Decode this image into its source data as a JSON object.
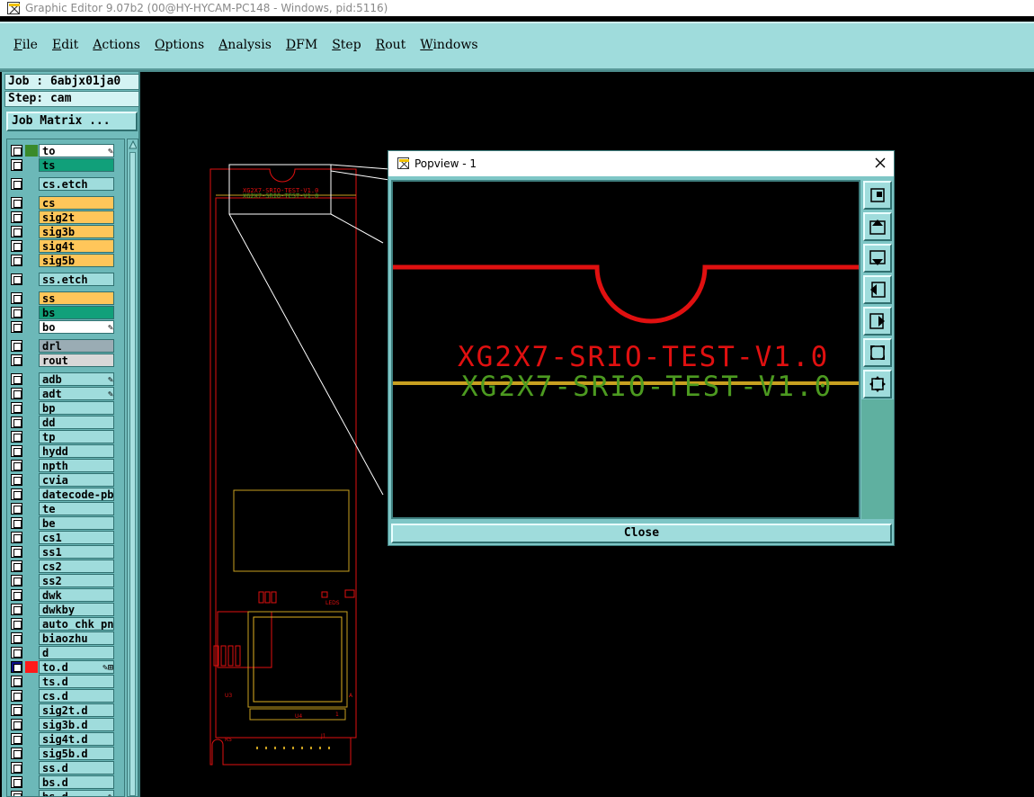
{
  "window": {
    "title": "Graphic Editor 9.07b2 (00@HY-HYCAM-PC148 - Windows, pid:5116)"
  },
  "menu": [
    {
      "label": "File"
    },
    {
      "label": "Edit"
    },
    {
      "label": "Actions"
    },
    {
      "label": "Options"
    },
    {
      "label": "Analysis"
    },
    {
      "label": "DFM"
    },
    {
      "label": "Step"
    },
    {
      "label": "Rout"
    },
    {
      "label": "Windows"
    }
  ],
  "job": {
    "job_text": "Job : 6abjx01ja0",
    "step_text": "Step: cam",
    "matrix_button": "Job Matrix ..."
  },
  "colors": {
    "accent_teal": "#9fdcdc",
    "board_red": "#e01010",
    "silk_yellow": "#c8a020",
    "text_green": "#4c9a20"
  },
  "layers": [
    {
      "name": "to",
      "bg": "#ffffff",
      "swatch": "#3a8a2a",
      "mark": "✎"
    },
    {
      "name": "ts",
      "bg": "#11a07a",
      "swatch": ""
    },
    {
      "name": "cs.etch",
      "bg": "#9fdcdc",
      "swatch": "",
      "gap": true
    },
    {
      "name": "cs",
      "bg": "#ffc65a",
      "swatch": "",
      "gap": true
    },
    {
      "name": "sig2t",
      "bg": "#ffc65a",
      "swatch": ""
    },
    {
      "name": "sig3b",
      "bg": "#ffc65a",
      "swatch": ""
    },
    {
      "name": "sig4t",
      "bg": "#ffc65a",
      "swatch": ""
    },
    {
      "name": "sig5b",
      "bg": "#ffc65a",
      "swatch": ""
    },
    {
      "name": "ss.etch",
      "bg": "#9fdcdc",
      "swatch": "",
      "gap": true
    },
    {
      "name": "ss",
      "bg": "#ffc65a",
      "swatch": "",
      "gap": true
    },
    {
      "name": "bs",
      "bg": "#11a07a",
      "swatch": ""
    },
    {
      "name": "bo",
      "bg": "#ffffff",
      "swatch": "",
      "mark": "✎"
    },
    {
      "name": "drl",
      "bg": "#9aacb4",
      "swatch": "",
      "gap": true
    },
    {
      "name": "rout",
      "bg": "#d8d8d8",
      "swatch": ""
    },
    {
      "name": "adb",
      "bg": "#9fdcdc",
      "swatch": "",
      "mark": "✎",
      "gap": true
    },
    {
      "name": "adt",
      "bg": "#9fdcdc",
      "swatch": "",
      "mark": "✎"
    },
    {
      "name": "bp",
      "bg": "#9fdcdc",
      "swatch": ""
    },
    {
      "name": "dd",
      "bg": "#9fdcdc",
      "swatch": ""
    },
    {
      "name": "tp",
      "bg": "#9fdcdc",
      "swatch": ""
    },
    {
      "name": "hydd",
      "bg": "#9fdcdc",
      "swatch": ""
    },
    {
      "name": "npth",
      "bg": "#9fdcdc",
      "swatch": ""
    },
    {
      "name": "cvia",
      "bg": "#9fdcdc",
      "swatch": ""
    },
    {
      "name": "datecode-pbe",
      "bg": "#9fdcdc",
      "swatch": ""
    },
    {
      "name": "te",
      "bg": "#9fdcdc",
      "swatch": ""
    },
    {
      "name": "be",
      "bg": "#9fdcdc",
      "swatch": ""
    },
    {
      "name": "cs1",
      "bg": "#9fdcdc",
      "swatch": ""
    },
    {
      "name": "ss1",
      "bg": "#9fdcdc",
      "swatch": ""
    },
    {
      "name": "cs2",
      "bg": "#9fdcdc",
      "swatch": ""
    },
    {
      "name": "ss2",
      "bg": "#9fdcdc",
      "swatch": ""
    },
    {
      "name": "dwk",
      "bg": "#9fdcdc",
      "swatch": ""
    },
    {
      "name": "dwkby",
      "bg": "#9fdcdc",
      "swatch": ""
    },
    {
      "name": "auto_chk_pn",
      "bg": "#9fdcdc",
      "swatch": ""
    },
    {
      "name": "biaozhu",
      "bg": "#9fdcdc",
      "swatch": ""
    },
    {
      "name": "d",
      "bg": "#9fdcdc",
      "swatch": ""
    },
    {
      "name": "to.d",
      "bg": "#9fdcdc",
      "swatch": "#ff1a1a",
      "mark": "✎⊞",
      "active": true
    },
    {
      "name": "ts.d",
      "bg": "#9fdcdc",
      "swatch": ""
    },
    {
      "name": "cs.d",
      "bg": "#9fdcdc",
      "swatch": ""
    },
    {
      "name": "sig2t.d",
      "bg": "#9fdcdc",
      "swatch": ""
    },
    {
      "name": "sig3b.d",
      "bg": "#9fdcdc",
      "swatch": ""
    },
    {
      "name": "sig4t.d",
      "bg": "#9fdcdc",
      "swatch": ""
    },
    {
      "name": "sig5b.d",
      "bg": "#9fdcdc",
      "swatch": ""
    },
    {
      "name": "ss.d",
      "bg": "#9fdcdc",
      "swatch": ""
    },
    {
      "name": "bs.d",
      "bg": "#9fdcdc",
      "swatch": ""
    },
    {
      "name": "bs.d",
      "bg": "#9fdcdc",
      "swatch": "",
      "mark": "✎"
    }
  ],
  "board": {
    "small_text_red": "XG2X7-SRIO-TEST-V1.0",
    "small_text_green": "XG2X7-SRIO-TEST-V1.0",
    "refdes": [
      "R16",
      "R18",
      "R20",
      "R19",
      "RATE1",
      "RATE2",
      "LEDS",
      "J3",
      "U3",
      "U4",
      "J1",
      "R5",
      "1",
      "A"
    ]
  },
  "popview": {
    "title": "Popview - 1",
    "text_red": "XG2X7-SRIO-TEST-V1.0",
    "text_green": "XG2X7-SRIO-TEST-V1.0",
    "close_label": "Close",
    "tools": [
      "zoom-home-icon",
      "pan-up-icon",
      "pan-down-icon",
      "pan-left-icon",
      "pan-right-icon",
      "zoom-fit-icon",
      "zoom-center-icon"
    ]
  }
}
